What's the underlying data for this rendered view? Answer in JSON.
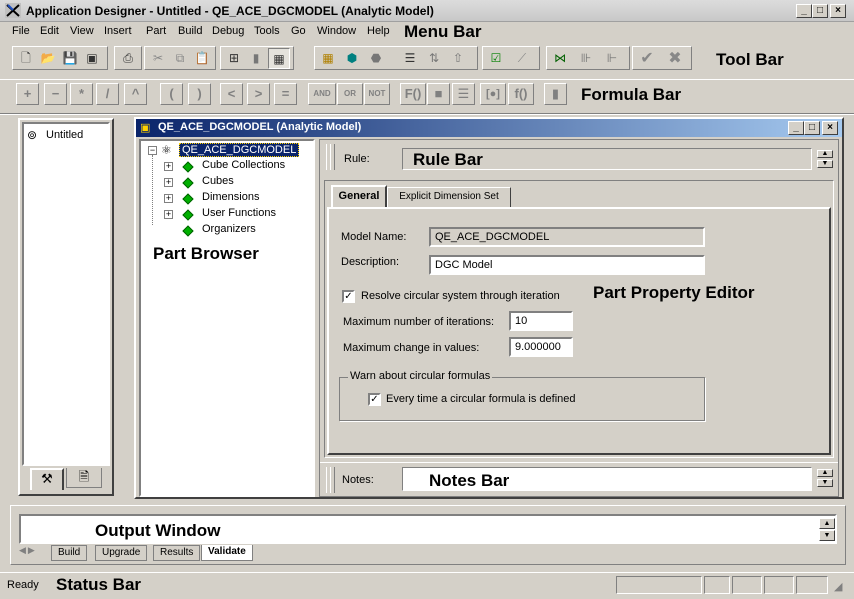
{
  "window": {
    "title": "Application Designer - Untitled - QE_ACE_DGCMODEL (Analytic Model)",
    "controls": [
      "_",
      "□",
      "×"
    ]
  },
  "menubar": {
    "items": [
      "File",
      "Edit",
      "View",
      "Insert",
      "Part",
      "Build",
      "Debug",
      "Tools",
      "Go",
      "Window",
      "Help"
    ],
    "callout": "Menu Bar"
  },
  "toolbar": {
    "callout": "Tool Bar",
    "icons": [
      "new-icon",
      "open-icon",
      "save-icon",
      "save-all-icon",
      "print-icon",
      "cut-icon",
      "copy-icon",
      "paste-icon",
      "properties-icon",
      "validate-icon",
      "project-icon",
      "table-icon",
      "cube-icon",
      "dimension-icon",
      "list-icon",
      "sort-icon",
      "move-icon",
      "check-icon",
      "wand-icon",
      "network-icon",
      "tree-icon",
      "hierarchy-icon",
      "accept-icon",
      "reject-icon"
    ]
  },
  "formula_bar": {
    "callout": "Formula Bar",
    "buttons": [
      "+",
      "−",
      "*",
      "/",
      "^",
      "(",
      ")",
      "<",
      ">",
      "=",
      "AND",
      "OR",
      "NOT",
      "F()",
      "■",
      "☰",
      "[●]",
      "f()",
      "▮"
    ]
  },
  "project_panel": {
    "root": "Untitled",
    "tabs": [
      "project-tab-icon",
      "objects-tab-icon"
    ]
  },
  "model_window": {
    "title": "QE_ACE_DGCMODEL (Analytic Model)",
    "controls": [
      "_",
      "□",
      "×"
    ]
  },
  "part_browser": {
    "callout": "Part Browser",
    "root": "QE_ACE_DGCMODEL",
    "children": [
      "Cube Collections",
      "Cubes",
      "Dimensions",
      "User Functions",
      "Organizers"
    ]
  },
  "rule_bar": {
    "label": "Rule:",
    "callout": "Rule Bar"
  },
  "property_editor": {
    "callout": "Part Property Editor",
    "tabs": [
      "General",
      "Explicit Dimension Set"
    ],
    "model_name_label": "Model Name:",
    "model_name_value": "QE_ACE_DGCMODEL",
    "description_label": "Description:",
    "description_value": "DGC Model",
    "resolve_label": "Resolve circular system through iteration",
    "resolve_checked": true,
    "max_iterations_label": "Maximum number of iterations:",
    "max_iterations_value": "10",
    "max_change_label": "Maximum change in values:",
    "max_change_value": "9.000000",
    "warn_group_label": "Warn about circular formulas",
    "warn_every_time_label": "Every time a circular formula is defined",
    "warn_checked": true
  },
  "notes_bar": {
    "label": "Notes:",
    "callout": "Notes Bar"
  },
  "output_window": {
    "callout": "Output Window",
    "tabs": [
      "Build",
      "Upgrade",
      "Results",
      "Validate"
    ],
    "active_tab": "Validate"
  },
  "status_bar": {
    "status": "Ready",
    "callout": "Status Bar"
  }
}
